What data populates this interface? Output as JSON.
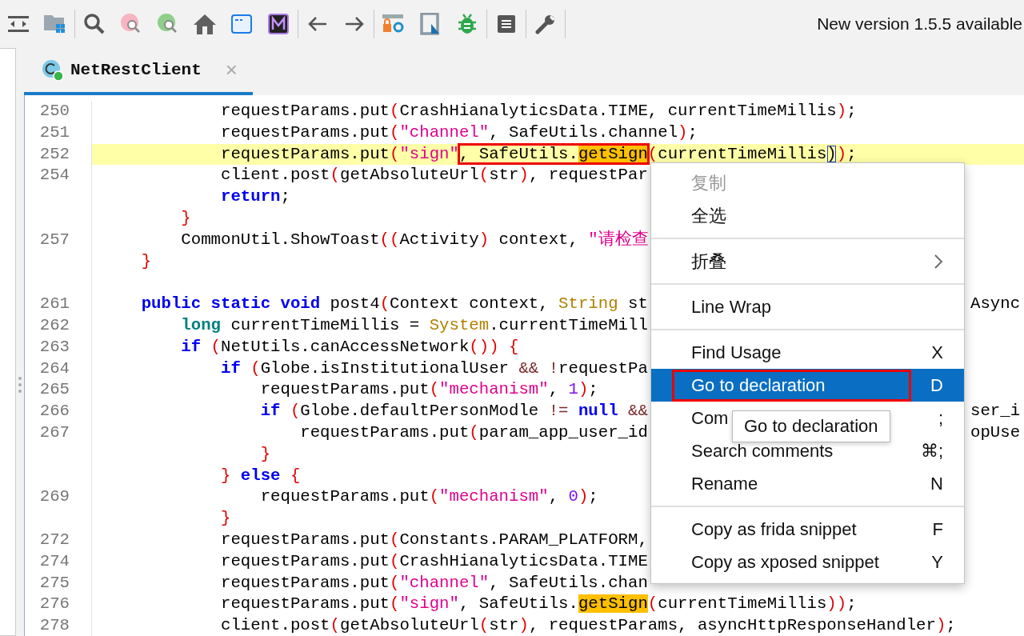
{
  "toolbar": {
    "notice": "New version 1.5.5 available"
  },
  "tabs": [
    {
      "label": "NetRestClient",
      "selected": true,
      "close": "×"
    }
  ],
  "code": {
    "lines": [
      {
        "kind": "code",
        "number": "250",
        "highlighted": false,
        "tokens": [
          {
            "text": "            requestParams.put",
            "kind": "plain"
          },
          {
            "text": "(",
            "kind": "paren"
          },
          {
            "text": "CrashHianalyticsData.TIME, currentTimeMillis",
            "kind": "plain"
          },
          {
            "text": ")",
            "kind": "paren"
          },
          {
            "text": ";",
            "kind": "plain"
          }
        ]
      },
      {
        "kind": "code",
        "number": "251",
        "highlighted": false,
        "tokens": [
          {
            "text": "            requestParams.put",
            "kind": "plain"
          },
          {
            "text": "(",
            "kind": "paren"
          },
          {
            "text": "\"channel\"",
            "kind": "str"
          },
          {
            "text": ", SafeUtils.channel",
            "kind": "plain"
          },
          {
            "text": ")",
            "kind": "paren"
          },
          {
            "text": ";",
            "kind": "plain"
          }
        ]
      },
      {
        "kind": "code",
        "number": "252",
        "highlighted": true,
        "tokens": [
          {
            "text": "            requestParams.put",
            "kind": "plain"
          },
          {
            "text": "(",
            "kind": "paren"
          },
          {
            "text": "\"sign\"",
            "kind": "str"
          },
          {
            "kind": "box",
            "tokens": [
              {
                "text": ", SafeUtils.",
                "kind": "plain"
              },
              {
                "text": "getSign",
                "kind": "occ"
              }
            ]
          },
          {
            "text": "(",
            "kind": "paren"
          },
          {
            "text": "currentTimeMillis",
            "kind": "plain"
          },
          {
            "text": ")",
            "kind": "match"
          },
          {
            "text": ")",
            "kind": "paren"
          },
          {
            "text": ";",
            "kind": "plain"
          }
        ]
      },
      {
        "kind": "code",
        "number": "254",
        "highlighted": false,
        "tokens": [
          {
            "text": "            client.post",
            "kind": "plain"
          },
          {
            "text": "(",
            "kind": "paren"
          },
          {
            "text": "getAbsoluteUrl",
            "kind": "plain"
          },
          {
            "text": "(",
            "kind": "paren"
          },
          {
            "text": "str",
            "kind": "plain"
          },
          {
            "text": ")",
            "kind": "paren"
          },
          {
            "text": ", requestPar",
            "kind": "plain"
          }
        ]
      },
      {
        "kind": "code",
        "highlighted": false,
        "tokens": [
          {
            "text": "            return",
            "kind": "kw"
          },
          {
            "text": ";",
            "kind": "plain"
          }
        ]
      },
      {
        "kind": "code",
        "highlighted": false,
        "tokens": [
          {
            "text": "        }",
            "kind": "paren"
          }
        ]
      },
      {
        "kind": "code",
        "number": "257",
        "highlighted": false,
        "tokens": [
          {
            "text": "        CommonUtil.ShowToast",
            "kind": "plain"
          },
          {
            "text": "((",
            "kind": "paren"
          },
          {
            "text": "Activity",
            "kind": "plain"
          },
          {
            "text": ")",
            "kind": "paren"
          },
          {
            "text": " context, ",
            "kind": "plain"
          },
          {
            "text": "\"请检查",
            "kind": "str"
          }
        ]
      },
      {
        "kind": "code",
        "highlighted": false,
        "tokens": [
          {
            "text": "    }",
            "kind": "paren"
          }
        ]
      },
      {
        "kind": "blank"
      },
      {
        "kind": "code",
        "number": "261",
        "highlighted": false,
        "tokens": [
          {
            "text": "    public static void",
            "kind": "kw"
          },
          {
            "text": " post4",
            "kind": "plain"
          },
          {
            "text": "(",
            "kind": "paren"
          },
          {
            "text": "Context context, ",
            "kind": "plain"
          },
          {
            "text": "String",
            "kind": "type"
          },
          {
            "text": " st",
            "kind": "plain"
          }
        ],
        "tail": "Async"
      },
      {
        "kind": "code",
        "number": "262",
        "highlighted": false,
        "tokens": [
          {
            "text": "        long",
            "kind": "kw2"
          },
          {
            "text": " currentTimeMillis = ",
            "kind": "plain"
          },
          {
            "text": "System",
            "kind": "type"
          },
          {
            "text": ".currentTimeMill",
            "kind": "plain"
          }
        ]
      },
      {
        "kind": "code",
        "number": "263",
        "highlighted": false,
        "tokens": [
          {
            "text": "        if ",
            "kind": "kw"
          },
          {
            "text": "(",
            "kind": "paren"
          },
          {
            "text": "NetUtils.canAccessNetwork",
            "kind": "plain"
          },
          {
            "text": "()) {",
            "kind": "paren"
          }
        ]
      },
      {
        "kind": "code",
        "number": "264",
        "highlighted": false,
        "tokens": [
          {
            "text": "            if ",
            "kind": "kw"
          },
          {
            "text": "(",
            "kind": "paren"
          },
          {
            "text": "Globe.isInstitutionalUser ",
            "kind": "plain"
          },
          {
            "text": "&& !",
            "kind": "op"
          },
          {
            "text": "requestPa",
            "kind": "plain"
          }
        ]
      },
      {
        "kind": "code",
        "number": "265",
        "highlighted": false,
        "tokens": [
          {
            "text": "                requestParams.put",
            "kind": "plain"
          },
          {
            "text": "(",
            "kind": "paren"
          },
          {
            "text": "\"mechanism\"",
            "kind": "str"
          },
          {
            "text": ", ",
            "kind": "plain"
          },
          {
            "text": "1",
            "kind": "num"
          },
          {
            "text": ")",
            "kind": "paren"
          },
          {
            "text": ";",
            "kind": "plain"
          }
        ]
      },
      {
        "kind": "code",
        "number": "266",
        "highlighted": false,
        "tokens": [
          {
            "text": "                if ",
            "kind": "kw"
          },
          {
            "text": "(",
            "kind": "paren"
          },
          {
            "text": "Globe.defaultPersonModle ",
            "kind": "plain"
          },
          {
            "text": "!= ",
            "kind": "op"
          },
          {
            "text": "null ",
            "kind": "kw"
          },
          {
            "text": "&&",
            "kind": "op"
          }
        ],
        "tail": "ser_i"
      },
      {
        "kind": "code",
        "number": "267",
        "highlighted": false,
        "tokens": [
          {
            "text": "                    requestParams.put",
            "kind": "plain"
          },
          {
            "text": "(",
            "kind": "paren"
          },
          {
            "text": "param_app_user_id",
            "kind": "plain"
          }
        ],
        "tail": "opUse"
      },
      {
        "kind": "code",
        "highlighted": false,
        "tokens": [
          {
            "text": "                }",
            "kind": "paren"
          }
        ]
      },
      {
        "kind": "code",
        "highlighted": false,
        "tokens": [
          {
            "text": "            } ",
            "kind": "paren"
          },
          {
            "text": "else ",
            "kind": "kw"
          },
          {
            "text": "{",
            "kind": "paren"
          }
        ]
      },
      {
        "kind": "code",
        "number": "269",
        "highlighted": false,
        "tokens": [
          {
            "text": "                requestParams.put",
            "kind": "plain"
          },
          {
            "text": "(",
            "kind": "paren"
          },
          {
            "text": "\"mechanism\"",
            "kind": "str"
          },
          {
            "text": ", ",
            "kind": "plain"
          },
          {
            "text": "0",
            "kind": "num"
          },
          {
            "text": ")",
            "kind": "paren"
          },
          {
            "text": ";",
            "kind": "plain"
          }
        ]
      },
      {
        "kind": "code",
        "highlighted": false,
        "tokens": [
          {
            "text": "            }",
            "kind": "paren"
          }
        ]
      },
      {
        "kind": "code",
        "number": "272",
        "highlighted": false,
        "tokens": [
          {
            "text": "            requestParams.put",
            "kind": "plain"
          },
          {
            "text": "(",
            "kind": "paren"
          },
          {
            "text": "Constants.PARAM_PLATFORM,",
            "kind": "plain"
          }
        ]
      },
      {
        "kind": "code",
        "number": "274",
        "highlighted": false,
        "tokens": [
          {
            "text": "            requestParams.put",
            "kind": "plain"
          },
          {
            "text": "(",
            "kind": "paren"
          },
          {
            "text": "CrashHianalyticsData.TIME",
            "kind": "plain"
          }
        ]
      },
      {
        "kind": "code",
        "number": "275",
        "highlighted": false,
        "tokens": [
          {
            "text": "            requestParams.put",
            "kind": "plain"
          },
          {
            "text": "(",
            "kind": "paren"
          },
          {
            "text": "\"channel\"",
            "kind": "str"
          },
          {
            "text": ", SafeUtils.chan",
            "kind": "plain"
          }
        ]
      },
      {
        "kind": "code",
        "number": "276",
        "highlighted": false,
        "tokens": [
          {
            "text": "            requestParams.put",
            "kind": "plain"
          },
          {
            "text": "(",
            "kind": "paren"
          },
          {
            "text": "\"sign\"",
            "kind": "str"
          },
          {
            "text": ", SafeUtils.",
            "kind": "plain"
          },
          {
            "text": "getSign",
            "kind": "occ"
          },
          {
            "text": "(",
            "kind": "paren"
          },
          {
            "text": "currentTimeMillis",
            "kind": "plain"
          },
          {
            "text": "))",
            "kind": "paren"
          },
          {
            "text": ";",
            "kind": "plain"
          }
        ]
      },
      {
        "kind": "code",
        "number": "278",
        "highlighted": false,
        "tokens": [
          {
            "text": "            client.post",
            "kind": "plain"
          },
          {
            "text": "(",
            "kind": "paren"
          },
          {
            "text": "getAbsoluteUrl",
            "kind": "plain"
          },
          {
            "text": "(",
            "kind": "paren"
          },
          {
            "text": "str",
            "kind": "plain"
          },
          {
            "text": ")",
            "kind": "paren"
          },
          {
            "text": ", requestParams, asyncHttpResponseHandler",
            "kind": "plain"
          },
          {
            "text": ")",
            "kind": "paren"
          },
          {
            "text": ";",
            "kind": "plain"
          }
        ]
      }
    ]
  },
  "context_menu": {
    "items": [
      {
        "kind": "item",
        "label": "复制",
        "disabled": true,
        "selected": false,
        "annotated": false
      },
      {
        "kind": "item",
        "label": "全选",
        "disabled": false,
        "selected": false,
        "annotated": false
      },
      {
        "kind": "separator"
      },
      {
        "kind": "item",
        "label": "折叠",
        "disabled": false,
        "selected": false,
        "submenu": true,
        "annotated": false
      },
      {
        "kind": "separator"
      },
      {
        "kind": "item",
        "label": "Line Wrap",
        "disabled": false,
        "selected": false,
        "annotated": false
      },
      {
        "kind": "separator"
      },
      {
        "kind": "item",
        "label": "Find Usage",
        "shortcut": "X",
        "disabled": false,
        "selected": false,
        "annotated": false
      },
      {
        "kind": "item",
        "label": "Go to declaration",
        "shortcut": "D",
        "disabled": false,
        "selected": true,
        "annotated": true
      },
      {
        "kind": "item",
        "label": "Com",
        "shortcut": ";",
        "disabled": false,
        "selected": false,
        "annotated": false
      },
      {
        "kind": "item",
        "label": "Search comments",
        "shortcut": "⌘;",
        "disabled": false,
        "selected": false,
        "annotated": false
      },
      {
        "kind": "item",
        "label": "Rename",
        "shortcut": "N",
        "disabled": false,
        "selected": false,
        "annotated": false
      },
      {
        "kind": "separator"
      },
      {
        "kind": "item",
        "label": "Copy as frida snippet",
        "shortcut": "F",
        "disabled": false,
        "selected": false,
        "annotated": false
      },
      {
        "kind": "item",
        "label": "Copy as xposed snippet",
        "shortcut": "Y",
        "disabled": false,
        "selected": false,
        "annotated": false
      }
    ]
  },
  "tooltip": {
    "text": "Go to declaration"
  }
}
